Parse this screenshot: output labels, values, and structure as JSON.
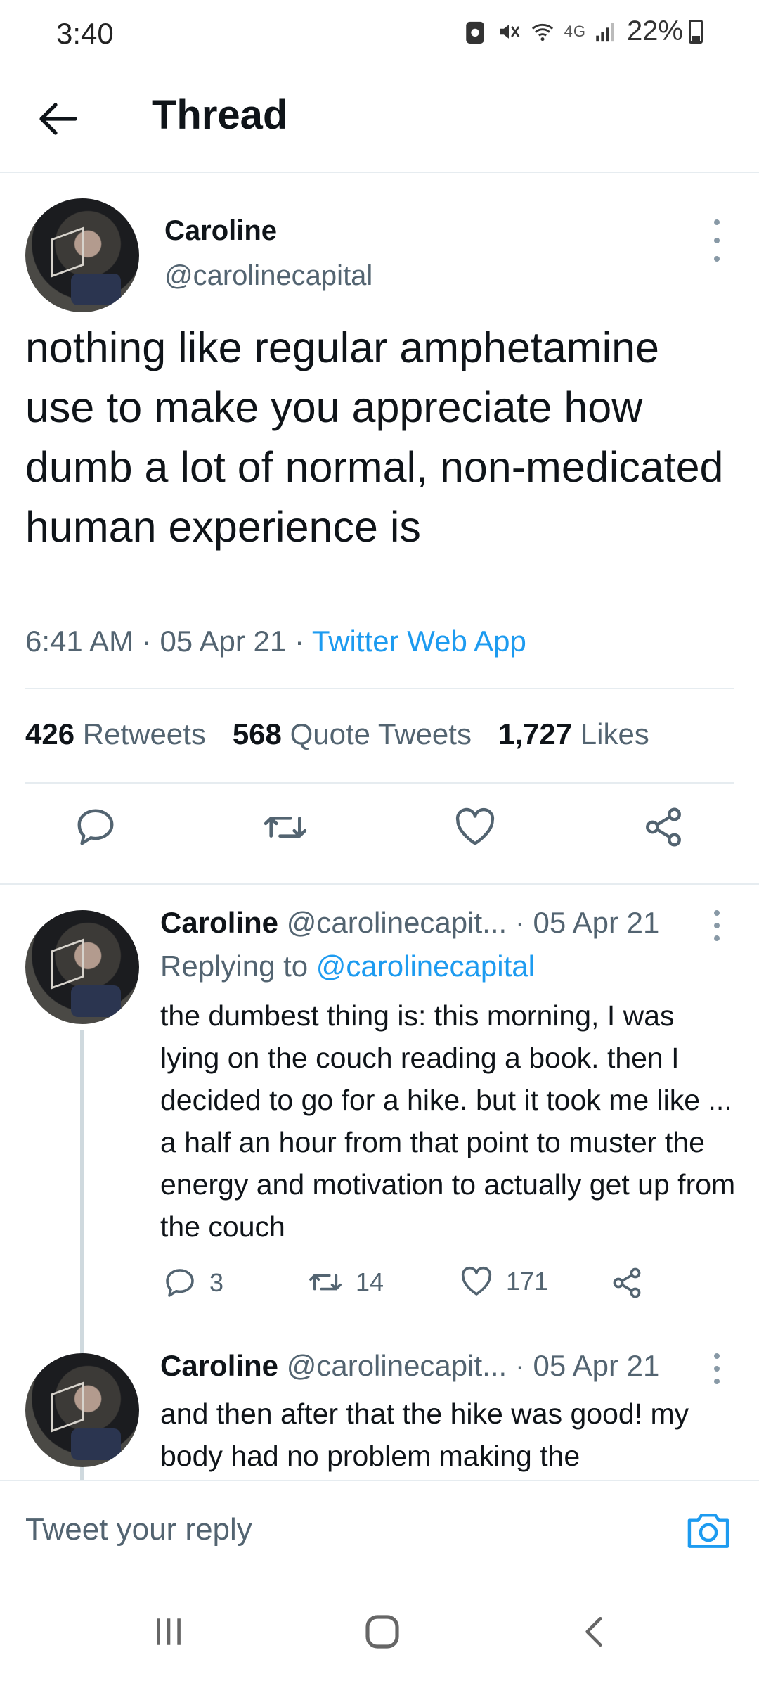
{
  "status_bar": {
    "time": "3:40",
    "network": "4G",
    "battery": "22%",
    "icons": [
      "notification-icon",
      "mute-icon",
      "wifi-icon",
      "signal-icon",
      "battery-icon"
    ]
  },
  "header": {
    "title": "Thread",
    "back_icon": "arrow-left-icon"
  },
  "main_tweet": {
    "name": "Caroline",
    "handle": "@carolinecapital",
    "text": "nothing like regular amphetamine use to make you appreciate how dumb a lot of normal, non-medicated human experience is",
    "time": "6:41 AM",
    "date": "05 Apr 21",
    "sep": "·",
    "app": "Twitter Web App",
    "stats": {
      "retweets_count": "426",
      "retweets_label": "Retweets",
      "quotes_count": "568",
      "quotes_label": "Quote Tweets",
      "likes_count": "1,727",
      "likes_label": "Likes"
    }
  },
  "replies": [
    {
      "name": "Caroline",
      "handle": "@carolinecapit...",
      "sep": "·",
      "date": "05 Apr 21",
      "replying_prefix": "Replying to",
      "replying_to": "@carolinecapital",
      "text": "the dumbest thing is: this morning, I was lying on the couch reading a book. then I decided to go for a hike. but it took me like ... a half an hour from that point to muster the energy and motivation to actually get up from the couch",
      "reply_count": "3",
      "retweet_count": "14",
      "like_count": "171"
    },
    {
      "name": "Caroline",
      "handle": "@carolinecapit...",
      "sep": "·",
      "date": "05 Apr 21",
      "text": "and then after that the hike was good! my body had no problem making the"
    }
  ],
  "reply_bar": {
    "placeholder": "Tweet your reply"
  },
  "colors": {
    "accent": "#1d9bf0",
    "text_primary": "#0f1419",
    "text_secondary": "#536471",
    "divider": "#e6ecf0"
  }
}
